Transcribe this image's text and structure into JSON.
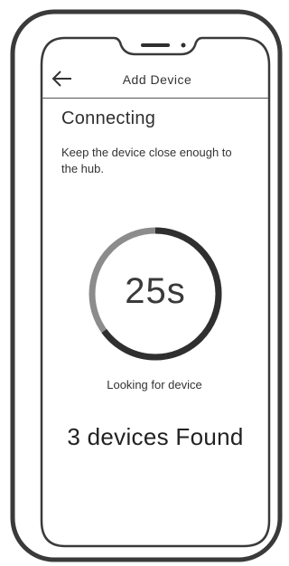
{
  "screen": {
    "title": "Add Device",
    "heading": "Connecting",
    "instruction": "Keep the device close enough to the hub.",
    "timer": "25s",
    "status": "Looking for device",
    "result": "3 devices Found"
  },
  "progress": {
    "fraction_complete": 0.65
  },
  "icons": {
    "back": "back-arrow-icon"
  },
  "colors": {
    "ring_progress": "#2f2f2f",
    "ring_track": "#8c8c8c",
    "frame": "#3a3a3a"
  }
}
